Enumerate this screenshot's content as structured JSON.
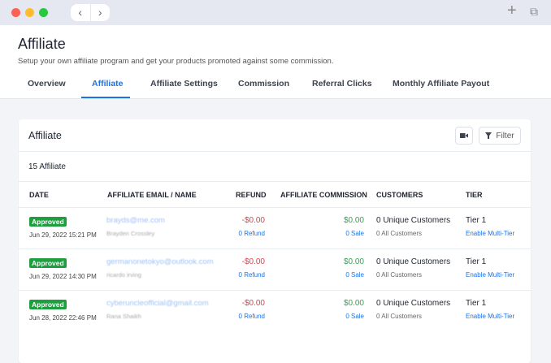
{
  "browser": {
    "back": "‹",
    "forward": "›",
    "new_tab": "+",
    "tabs": "⧉"
  },
  "header": {
    "title": "Affiliate",
    "subtitle": "Setup your own affiliate program and get your products promoted against some commission."
  },
  "tabs": [
    {
      "label": "Overview"
    },
    {
      "label": "Affiliate"
    },
    {
      "label": "Affiliate Settings"
    },
    {
      "label": "Commission"
    },
    {
      "label": "Referral Clicks"
    },
    {
      "label": "Monthly Affiliate Payout"
    }
  ],
  "card": {
    "title": "Affiliate",
    "filter_label": "Filter",
    "count": "15 Affiliate"
  },
  "columns": [
    "DATE",
    "AFFILIATE EMAIL / NAME",
    "REFUND",
    "AFFILIATE COMMISSION",
    "CUSTOMERS",
    "TIER"
  ],
  "rows": [
    {
      "status": "Approved",
      "date": "Jun 29, 2022 15:21 PM",
      "email": "brayds@me.com",
      "name": "Brayden Crossley",
      "refund": "-$0.00",
      "refund_link": "0 Refund",
      "commission": "$0.00",
      "sale_link": "0 Sale",
      "customers": "0 Unique Customers",
      "all_customers": "0 All Customers",
      "tier": "Tier 1",
      "tier_link": "Enable Multi-Tier"
    },
    {
      "status": "Approved",
      "date": "Jun 29, 2022 14:30 PM",
      "email": "germanonetokyo@outlook.com",
      "name": "ricardo irving",
      "refund": "-$0.00",
      "refund_link": "0 Refund",
      "commission": "$0.00",
      "sale_link": "0 Sale",
      "customers": "0 Unique Customers",
      "all_customers": "0 All Customers",
      "tier": "Tier 1",
      "tier_link": "Enable Multi-Tier"
    },
    {
      "status": "Approved",
      "date": "Jun 28, 2022 22:46 PM",
      "email": "cyberuncleofficial@gmail.com",
      "name": "Rana Shaikh",
      "refund": "-$0.00",
      "refund_link": "0 Refund",
      "commission": "$0.00",
      "sale_link": "0 Sale",
      "customers": "0 Unique Customers",
      "all_customers": "0 All Customers",
      "tier": "Tier 1",
      "tier_link": "Enable Multi-Tier"
    }
  ]
}
